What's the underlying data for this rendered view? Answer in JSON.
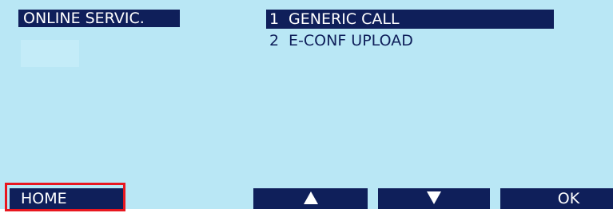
{
  "header": {
    "title": "ONLINE SERVIC."
  },
  "menu": {
    "items": [
      {
        "number": "1",
        "label": "GENERIC CALL",
        "selected": true
      },
      {
        "number": "2",
        "label": "E-CONF UPLOAD",
        "selected": false
      }
    ]
  },
  "softkeys": {
    "home_label": "HOME",
    "up_icon": "up-triangle-icon",
    "down_icon": "down-triangle-icon",
    "ok_label": "OK"
  },
  "colors": {
    "screen_background": "#b9e7f5",
    "bar": "#0f1f5a",
    "highlight_outline": "#e8171f"
  }
}
